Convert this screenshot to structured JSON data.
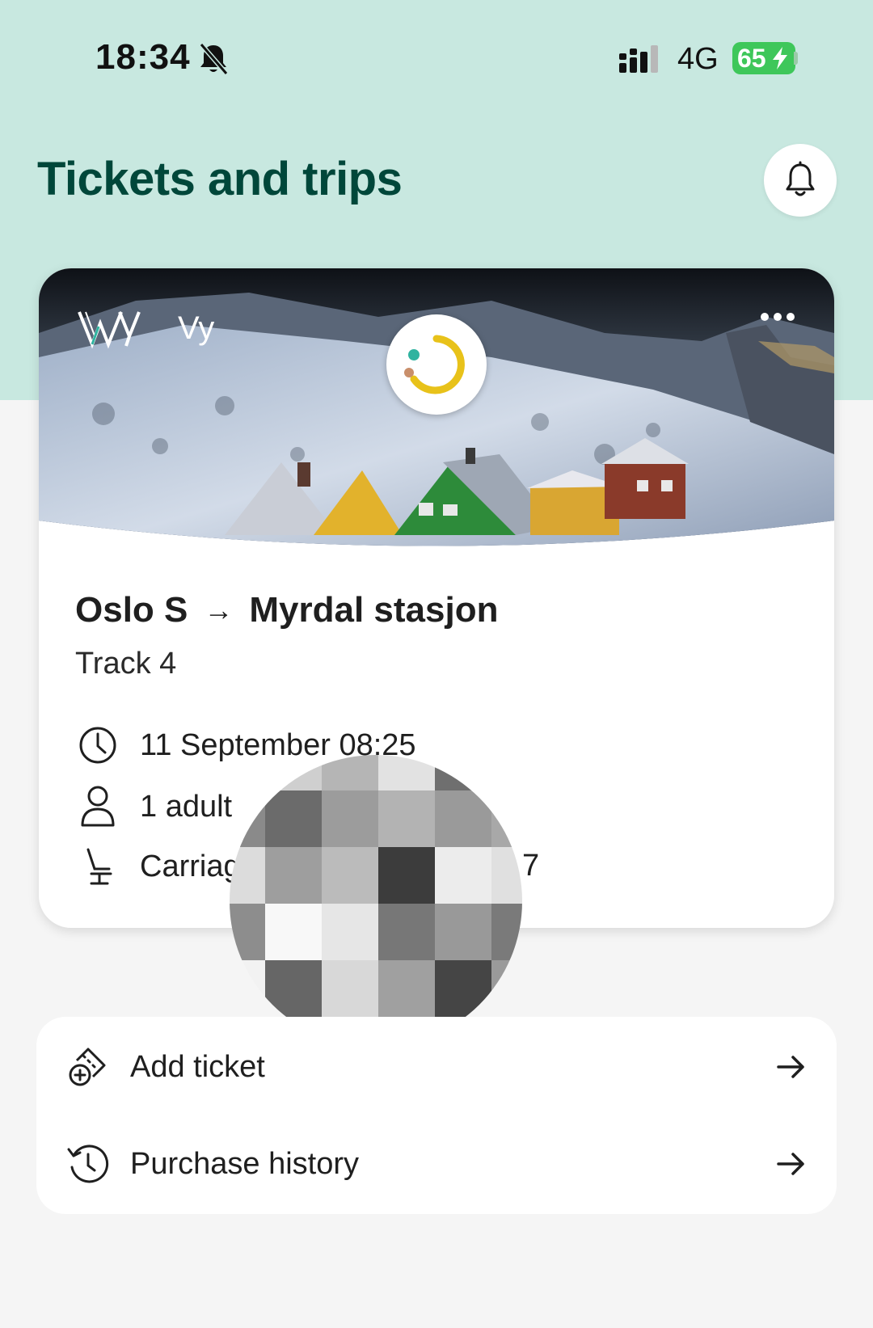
{
  "status_bar": {
    "time": "18:34",
    "network": "4G",
    "battery": "65"
  },
  "header": {
    "title": "Tickets and trips"
  },
  "ticket": {
    "operator": "Vy",
    "from": "Oslo S",
    "arrow": "→",
    "to": "Myrdal stasjon",
    "track": "Track 4",
    "datetime": "11 September 08:25",
    "passengers": "1 adult",
    "seat_prefix": "Carriag",
    "seat_suffix": "7"
  },
  "actions": {
    "add_ticket": "Add ticket",
    "purchase_history": "Purchase history"
  },
  "colors": {
    "top_band": "#c8e8e0",
    "title_green": "#00473a",
    "battery_green": "#3ec75a",
    "status_yellow": "#e8c21a",
    "status_teal": "#2fb3a0",
    "status_brown": "#c98f6b"
  }
}
